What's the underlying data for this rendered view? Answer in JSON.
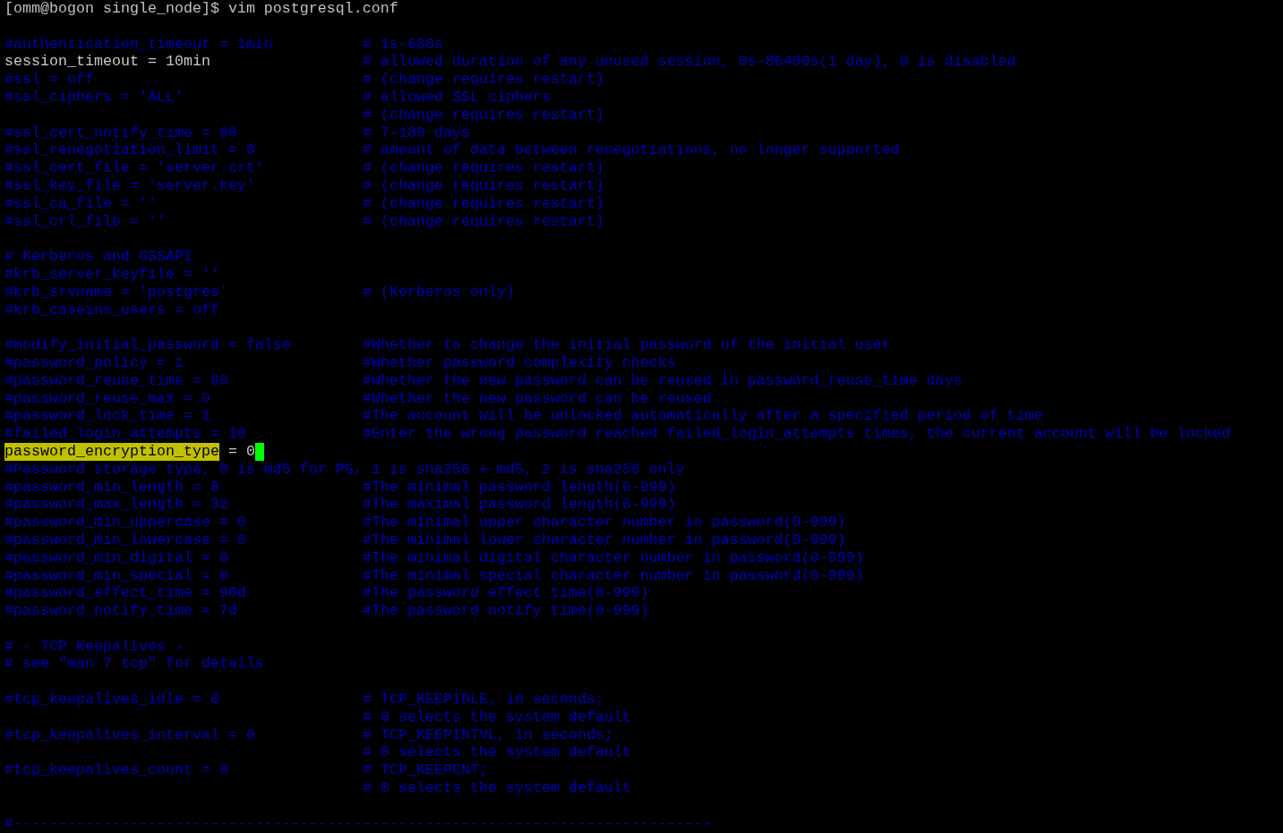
{
  "prompt": "[omm@bogon single_node]$ vim postgresql.conf",
  "lines": [
    {
      "kind": "blank"
    },
    {
      "kind": "commented",
      "code": "#authentication_timeout = 1min",
      "comment": "# 1s-600s"
    },
    {
      "kind": "setting",
      "code": "session_timeout = 10min",
      "comment": "# allowed duration of any unused session, 0s-86400s(1 day), 0 is disabled"
    },
    {
      "kind": "commented",
      "code": "#ssl = off",
      "comment": "# (change requires restart)"
    },
    {
      "kind": "commented",
      "code": "#ssl_ciphers = 'ALL'",
      "comment": "# allowed SSL ciphers"
    },
    {
      "kind": "commented",
      "comment": "# (change requires restart)"
    },
    {
      "kind": "commented",
      "code": "#ssl_cert_notify_time = 90",
      "comment": "# 7-180 days"
    },
    {
      "kind": "commented",
      "code": "#ssl_renegotiation_limit = 0",
      "comment": "# amount of data between renegotiations, no longer supported"
    },
    {
      "kind": "commented",
      "code": "#ssl_cert_file = 'server.crt'",
      "comment": "# (change requires restart)"
    },
    {
      "kind": "commented",
      "code": "#ssl_key_file = 'server.key'",
      "comment": "# (change requires restart)"
    },
    {
      "kind": "commented",
      "code": "#ssl_ca_file = ''",
      "comment": "# (change requires restart)"
    },
    {
      "kind": "commented",
      "code": "#ssl_crl_file = ''",
      "comment": "# (change requires restart)"
    },
    {
      "kind": "blank"
    },
    {
      "kind": "commented",
      "code": "# Kerberos and GSSAPI"
    },
    {
      "kind": "commented",
      "code": "#krb_server_keyfile = ''"
    },
    {
      "kind": "commented",
      "code": "#krb_srvname = 'postgres'",
      "comment": "# (Kerberos only)"
    },
    {
      "kind": "commented",
      "code": "#krb_caseins_users = off"
    },
    {
      "kind": "blank"
    },
    {
      "kind": "commented",
      "code": "#modify_initial_password = false",
      "comment": "#Whether to change the initial password of the initial user"
    },
    {
      "kind": "commented",
      "code": "#password_policy = 1",
      "comment": "#Whether password complexity checks"
    },
    {
      "kind": "commented",
      "code": "#password_reuse_time = 60",
      "comment": "#Whether the new password can be reused in password_reuse_time days"
    },
    {
      "kind": "commented",
      "code": "#password_reuse_max = 0",
      "comment": "#Whether the new password can be reused"
    },
    {
      "kind": "commented",
      "code": "#password_lock_time = 1",
      "comment": "#The account will be unlocked automatically after a specified period of time"
    },
    {
      "kind": "commented",
      "code": "#failed_login_attempts = 10",
      "comment": "#Enter the wrong password reached failed_login_attempts times, the current account will be locked"
    },
    {
      "kind": "setting",
      "search_match": "password_encryption_type",
      "code": " = 0",
      "cursor": true
    },
    {
      "kind": "commented",
      "code": "#Password storage type, 0 is md5 for PG, 1 is sha256 + md5, 2 is sha256 only"
    },
    {
      "kind": "commented",
      "code": "#password_min_length = 8",
      "comment": "#The minimal password length(6-999)"
    },
    {
      "kind": "commented",
      "code": "#password_max_length = 32",
      "comment": "#The maximal password length(6-999)"
    },
    {
      "kind": "commented",
      "code": "#password_min_uppercase = 0",
      "comment": "#The minimal upper character number in password(0-999)"
    },
    {
      "kind": "commented",
      "code": "#password_min_lowercase = 0",
      "comment": "#The minimal lower character number in password(0-999)"
    },
    {
      "kind": "commented",
      "code": "#password_min_digital = 0",
      "comment": "#The minimal digital character number in password(0-999)"
    },
    {
      "kind": "commented",
      "code": "#password_min_special = 0",
      "comment": "#The minimal special character number in password(0-999)"
    },
    {
      "kind": "commented",
      "code": "#password_effect_time = 90d",
      "comment": "#The password effect time(0-999)"
    },
    {
      "kind": "commented",
      "code": "#password_notify_time = 7d",
      "comment": "#The password notify time(0-999)"
    },
    {
      "kind": "blank"
    },
    {
      "kind": "commented",
      "code": "# - TCP Keepalives -"
    },
    {
      "kind": "commented",
      "code": "# see \"man 7 tcp\" for details"
    },
    {
      "kind": "blank"
    },
    {
      "kind": "commented",
      "code": "#tcp_keepalives_idle = 0",
      "comment": "# TCP_KEEPIDLE, in seconds;"
    },
    {
      "kind": "commented",
      "comment": "# 0 selects the system default"
    },
    {
      "kind": "commented",
      "code": "#tcp_keepalives_interval = 0",
      "comment": "# TCP_KEEPINTVL, in seconds;"
    },
    {
      "kind": "commented",
      "comment": "# 0 selects the system default"
    },
    {
      "kind": "commented",
      "code": "#tcp_keepalives_count = 0",
      "comment": "# TCP_KEEPCNT;"
    },
    {
      "kind": "commented",
      "comment": "# 0 selects the system default"
    },
    {
      "kind": "blank"
    },
    {
      "kind": "commented",
      "code": "#------------------------------------------------------------------------------"
    }
  ]
}
